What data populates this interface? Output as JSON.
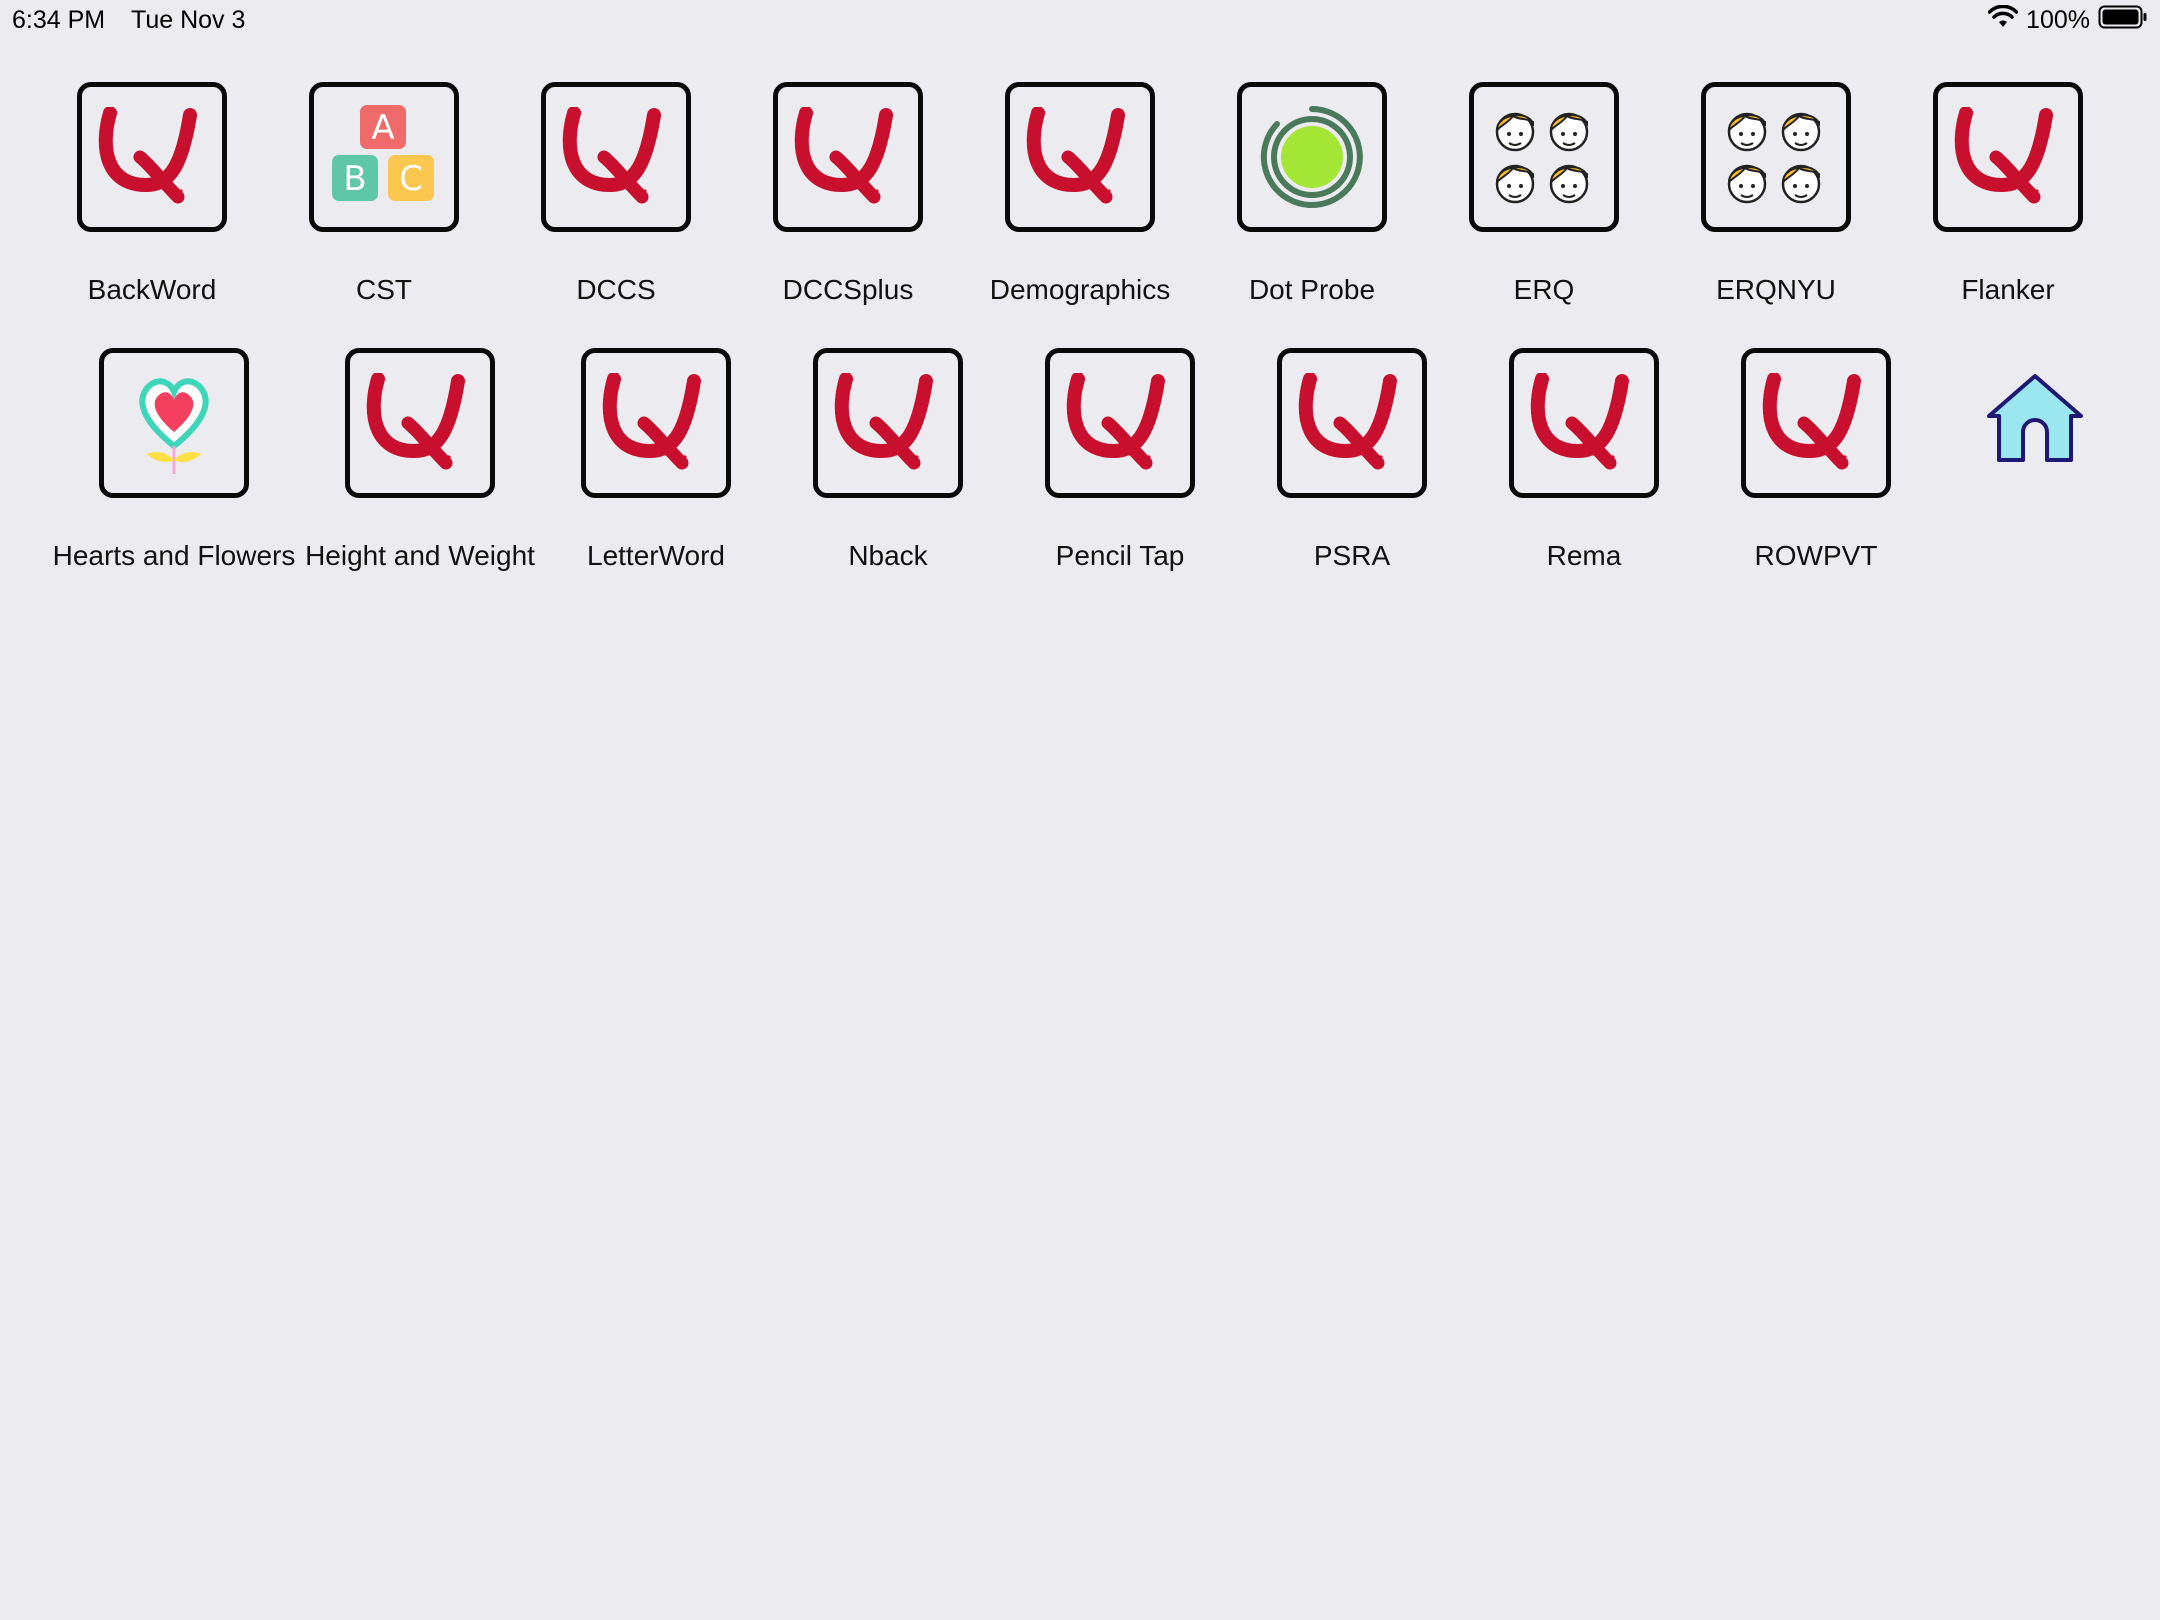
{
  "status_bar": {
    "time": "6:34 PM",
    "date": "Tue Nov 3",
    "battery": "100%",
    "wifi_icon": "wifi-icon",
    "battery_icon": "battery-icon"
  },
  "apps": [
    {
      "label": "BackWord",
      "icon": "q-logo-icon"
    },
    {
      "label": "CST",
      "icon": "abc-blocks-icon"
    },
    {
      "label": "DCCS",
      "icon": "q-logo-icon"
    },
    {
      "label": "DCCSplus",
      "icon": "q-logo-icon"
    },
    {
      "label": "Demographics",
      "icon": "q-logo-icon"
    },
    {
      "label": "Dot Probe",
      "icon": "target-dot-icon"
    },
    {
      "label": "ERQ",
      "icon": "faces-icon"
    },
    {
      "label": "ERQNYU",
      "icon": "faces-icon"
    },
    {
      "label": "Flanker",
      "icon": "q-logo-icon"
    },
    {
      "label": "Hearts and Flowers",
      "icon": "heart-flower-icon"
    },
    {
      "label": "Height and Weight",
      "icon": "q-logo-icon"
    },
    {
      "label": "LetterWord",
      "icon": "q-logo-icon"
    },
    {
      "label": "Nback",
      "icon": "q-logo-icon"
    },
    {
      "label": "Pencil Tap",
      "icon": "q-logo-icon"
    },
    {
      "label": "PSRA",
      "icon": "q-logo-icon"
    },
    {
      "label": "Rema",
      "icon": "q-logo-icon"
    },
    {
      "label": "ROWPVT",
      "icon": "q-logo-icon"
    },
    {
      "label": "",
      "icon": "home-icon"
    }
  ],
  "colors": {
    "background": "#ebebf0",
    "q_logo": "#c8102e",
    "dot_probe_ring": "#4a7a5a",
    "dot_probe_fill": "#a3e635",
    "home_fill": "#9be7f0",
    "home_stroke": "#1e1873"
  }
}
